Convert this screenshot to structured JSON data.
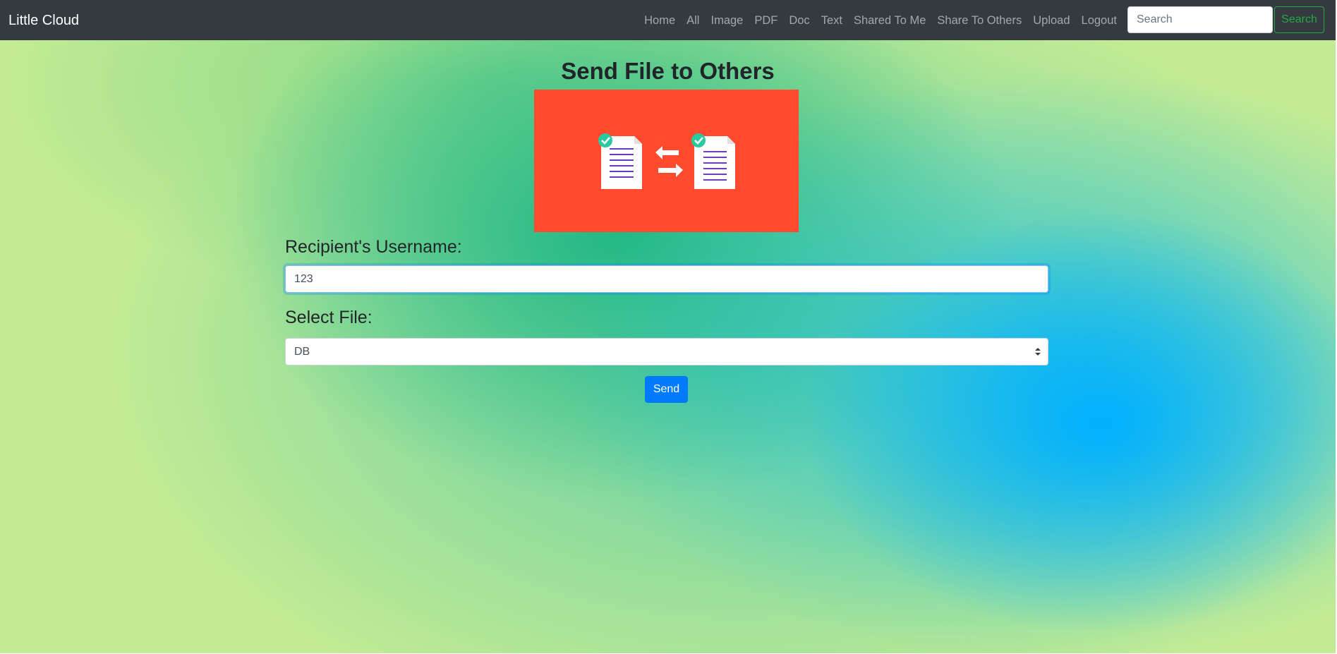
{
  "navbar": {
    "brand": "Little Cloud",
    "links": [
      {
        "label": "Home"
      },
      {
        "label": "All"
      },
      {
        "label": "Image"
      },
      {
        "label": "PDF"
      },
      {
        "label": "Doc"
      },
      {
        "label": "Text"
      },
      {
        "label": "Shared To Me"
      },
      {
        "label": "Share To Others"
      },
      {
        "label": "Upload"
      },
      {
        "label": "Logout"
      }
    ],
    "search_placeholder": "Search",
    "search_button": "Search"
  },
  "main": {
    "title": "Send File to Others",
    "banner_icon": "file-transfer-icon",
    "recipient_label": "Recipient's Username:",
    "recipient_value": "123",
    "file_label": "Select File:",
    "file_selected": "DB",
    "send_button": "Send"
  },
  "colors": {
    "navbar_bg": "#343a40",
    "banner_bg": "#ff4a2d",
    "primary": "#007bff",
    "success": "#28a745",
    "doc_line": "#6a3fbd",
    "check": "#2bc9a0"
  }
}
